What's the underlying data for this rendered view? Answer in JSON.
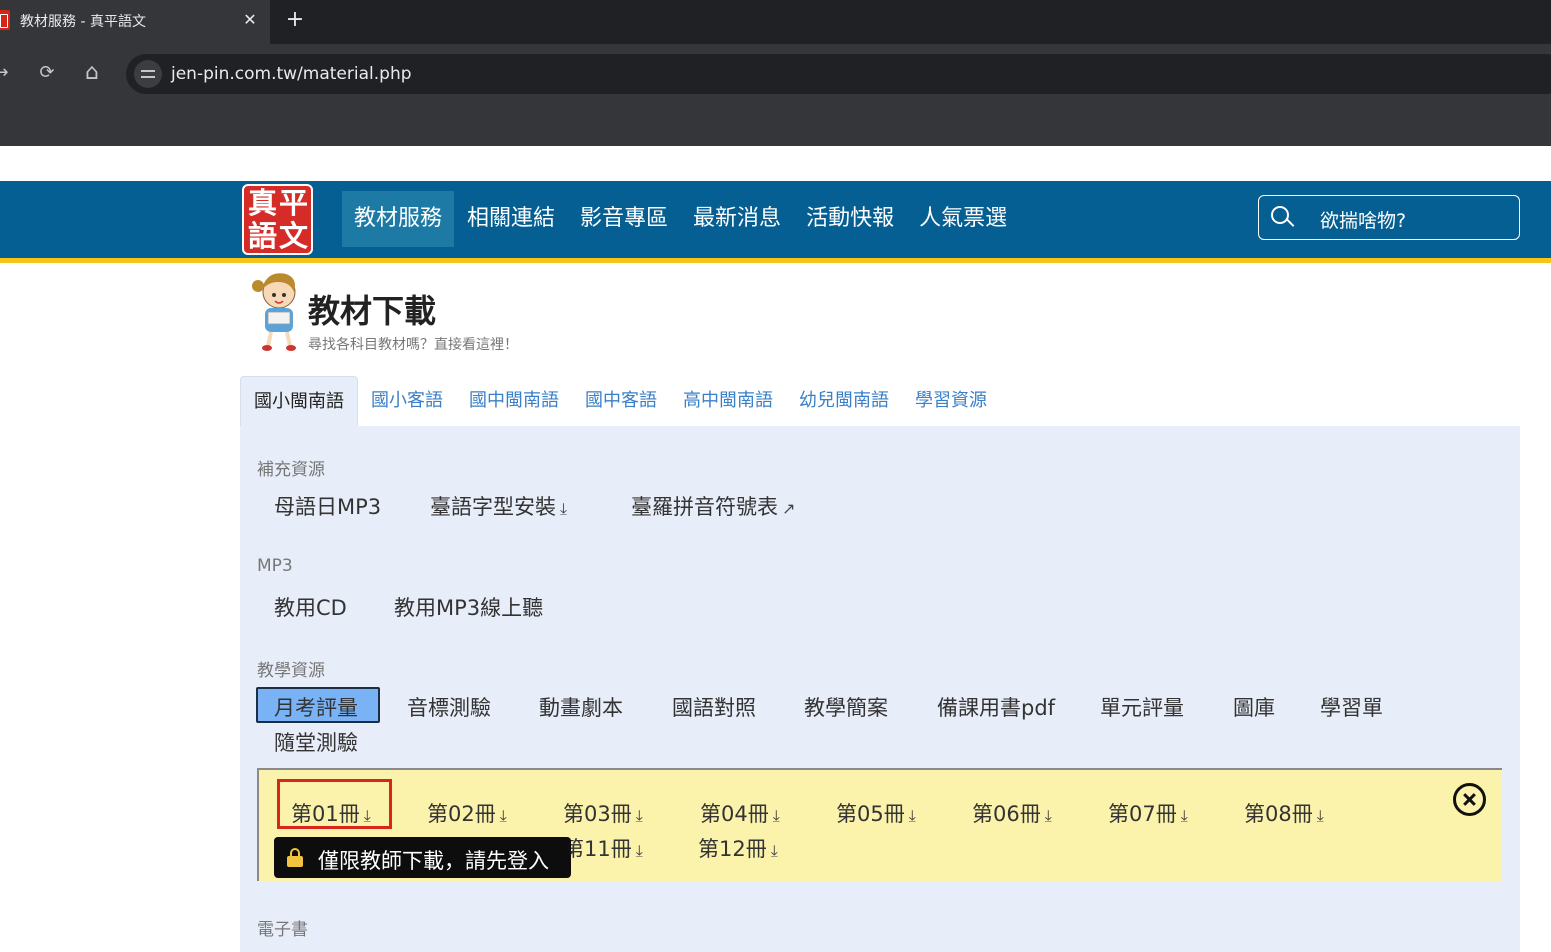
{
  "browser": {
    "tab_title": "教材服務 - 真平語文",
    "tab_close": "✕",
    "new_tab": "+",
    "back": "←",
    "forward": "→",
    "reload": "⟳",
    "home": "⌂",
    "url": "jen-pin.com.tw/material.php"
  },
  "site": {
    "logo": [
      "真",
      "平",
      "語",
      "文"
    ],
    "nav": [
      "教材服務",
      "相關連結",
      "影音專區",
      "最新消息",
      "活動快報",
      "人氣票選"
    ],
    "search_placeholder": "欲揣啥物?",
    "colors": {
      "nav_bg": "#055f92",
      "stripe": "#f5c518",
      "logo_red": "#d52c27"
    }
  },
  "page": {
    "title": "教材下載",
    "subtitle": "尋找各科目教材嗎？直接看這裡！"
  },
  "subject_tabs": [
    "國小閩南語",
    "國小客語",
    "國中閩南語",
    "國中客語",
    "高中閩南語",
    "幼兒閩南語",
    "學習資源"
  ],
  "sections": {
    "supplement": {
      "label": "補充資源",
      "items": [
        "母語日MP3",
        "臺語字型安裝",
        "臺羅拼音符號表"
      ]
    },
    "mp3": {
      "label": "MP3",
      "items": [
        "教用CD",
        "教用MP3線上聽"
      ]
    },
    "teaching": {
      "label": "教學資源",
      "items": [
        "月考評量",
        "音標測驗",
        "動畫劇本",
        "國語對照",
        "教學簡案",
        "備課用書pdf",
        "單元評量",
        "圖庫",
        "學習單",
        "隨堂測驗"
      ]
    },
    "volumes": [
      "第01冊",
      "第02冊",
      "第03冊",
      "第04冊",
      "第05冊",
      "第06冊",
      "第07冊",
      "第08冊",
      "第11冊",
      "第12冊"
    ],
    "ebook": {
      "label": "電子書"
    }
  },
  "tooltip": "僅限教師下載，請先登入",
  "icons": {
    "download": "⤓",
    "external": "↗"
  }
}
